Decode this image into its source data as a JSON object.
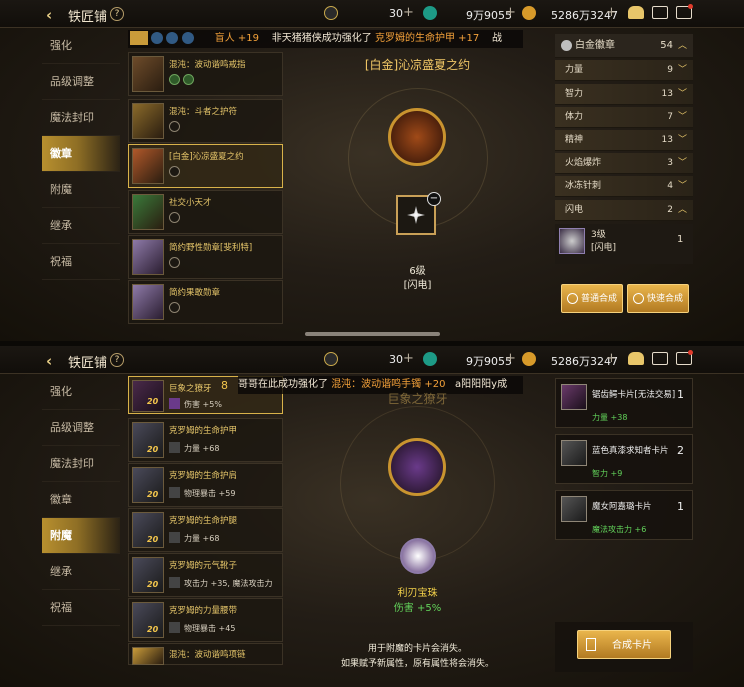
{
  "header": {
    "back_icon": "‹",
    "title": "铁匠铺",
    "help": "?"
  },
  "p1": {
    "currencies": {
      "a": "30",
      "b": "9万9055",
      "c": "5286万3247"
    },
    "nav": [
      "强化",
      "品级调整",
      "魔法封印",
      "徽章",
      "附魔",
      "继承",
      "祝福"
    ],
    "active_nav": "徽章",
    "ticker": {
      "a": "盲人 +19",
      "b": "非天猪猪侠成功强化了",
      "c": "克罗姆的生命护甲 +17",
      "d": "战"
    },
    "items": [
      {
        "name": "混沌：波动谐鸣戒指"
      },
      {
        "name": "混沌：斗者之护符"
      },
      {
        "name": "[白金]沁凉盛夏之约"
      },
      {
        "name": "社交小天才"
      },
      {
        "name": "简约野性勋章[斐利特]"
      },
      {
        "name": "简约果敢勋章"
      }
    ],
    "center": {
      "title": "[白金]沁凉盛夏之约",
      "level": "6级",
      "type": "[闪电]"
    },
    "stats_header": {
      "label": "白金徽章",
      "value": "54"
    },
    "stats": [
      {
        "label": "力量",
        "value": "9"
      },
      {
        "label": "智力",
        "value": "13"
      },
      {
        "label": "体力",
        "value": "7"
      },
      {
        "label": "精神",
        "value": "13"
      },
      {
        "label": "火焰爆炸",
        "value": "3"
      },
      {
        "label": "冰冻针刺",
        "value": "4"
      },
      {
        "label": "闪电",
        "value": "2"
      }
    ],
    "sub_item": {
      "level": "3级",
      "type": "[闪电]",
      "count": "1"
    },
    "buttons": {
      "normal": "普通合成",
      "fast": "快速合成"
    }
  },
  "p2": {
    "currencies": {
      "a": "30",
      "b": "9万9055",
      "c": "5286万3247"
    },
    "nav": [
      "强化",
      "品级调整",
      "魔法封印",
      "徽章",
      "附魔",
      "继承",
      "祝福"
    ],
    "active_nav": "附魔",
    "ticker": {
      "a": "哥哥在此成功强化了",
      "b": "混沌：波动谐鸣手镯 +20",
      "c": "a阳阳阳y成"
    },
    "items": [
      {
        "name": "巨象之獠牙",
        "level": "20",
        "stat": "伤害 +5%",
        "count": "8"
      },
      {
        "name": "克罗姆的生命护甲",
        "level": "20",
        "stat": "力量 +68"
      },
      {
        "name": "克罗姆的生命护肩",
        "level": "20",
        "stat": "物理暴击 +59"
      },
      {
        "name": "克罗姆的生命护腿",
        "level": "20",
        "stat": "力量 +68"
      },
      {
        "name": "克罗姆的元气靴子",
        "level": "20",
        "stat": "攻击力 +35, 魔法攻击力"
      },
      {
        "name": "克罗姆的力量腰带",
        "level": "20",
        "stat": "物理暴击 +45"
      },
      {
        "name": "混沌：波动谐鸣项链"
      }
    ],
    "center": {
      "title": "巨象之獠牙",
      "gem_name": "利刃宝珠",
      "gem_stat": "伤害 +5%",
      "note1": "用于附魔的卡片会消失。",
      "note2": "如果赋予新属性，原有属性将会消失。"
    },
    "cards": [
      {
        "name": "锯齿鳄卡片[无法交易]",
        "stat": "力量 +38",
        "count": "1"
      },
      {
        "name": "蓝色真漆求知者卡片",
        "stat": "智力 +9",
        "count": "2"
      },
      {
        "name": "魔女阿嘉璐卡片",
        "stat": "魔法攻击力 +6",
        "count": "1"
      }
    ],
    "combine_button": "合成卡片"
  }
}
